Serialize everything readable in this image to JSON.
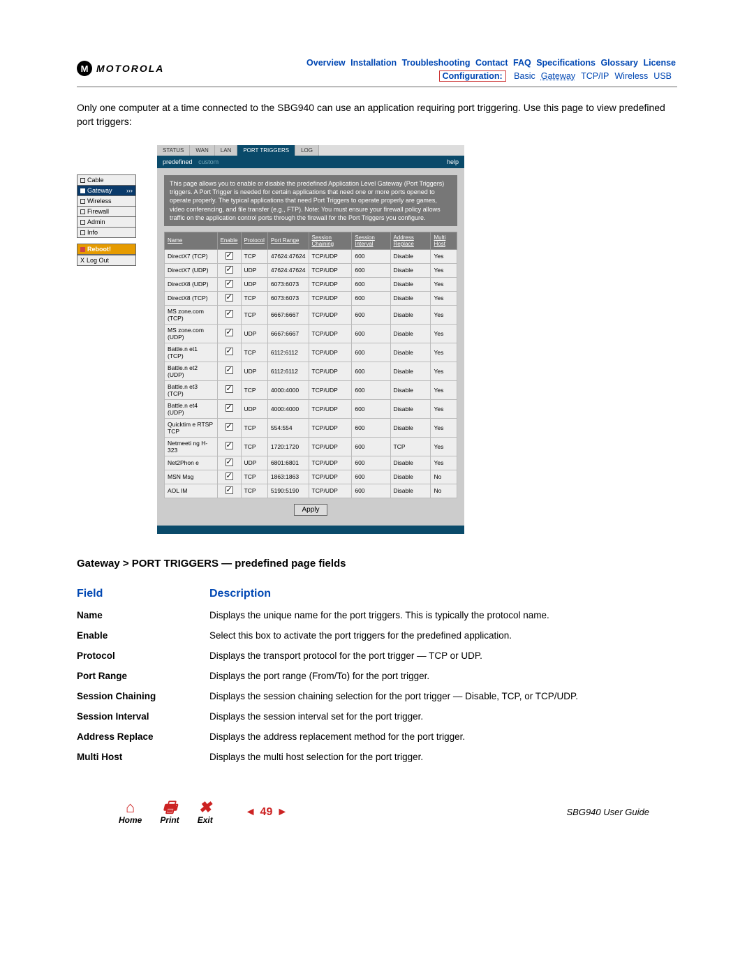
{
  "header": {
    "brand": "MOTOROLA",
    "top_links": [
      "Overview",
      "Installation",
      "Troubleshooting",
      "Contact",
      "FAQ",
      "Specifications",
      "Glossary",
      "License"
    ],
    "conf_label": "Configuration:",
    "conf_links": [
      "Basic",
      "Gateway",
      "TCP/IP",
      "Wireless",
      "USB"
    ]
  },
  "intro": "Only one computer at a time connected to the SBG940 can use an application requiring port triggering. Use this page to view predefined port triggers:",
  "sidenav": {
    "items": [
      "Cable",
      "Gateway",
      "Wireless",
      "Firewall",
      "Admin",
      "Info"
    ],
    "active_index": 1,
    "active_suffix": "›››",
    "reboot": "Reboot!",
    "logout": "Log Out"
  },
  "panel": {
    "tabs": [
      "STATUS",
      "WAN",
      "LAN",
      "PORT TRIGGERS",
      "LOG"
    ],
    "active_tab": 3,
    "subtab_active": "predefined",
    "subtab_inactive": "custom",
    "help": "help",
    "description": "This page allows you to enable or disable the predefined Application Level Gateway (Port Triggers) triggers. A Port Trigger is needed for certain applications that need one or more ports opened to operate properly. The typical applications that need Port Triggers to operate properly are games, video conferencing, and file transfer (e.g., FTP). Note: You must ensure your firewall policy allows traffic on the application control ports through the firewall for the Port Triggers you configure.",
    "columns": [
      "Name",
      "Enable",
      "Protocol",
      "Port Range",
      "Session Chaining",
      "Session Interval",
      "Address Replace",
      "Multi Host"
    ],
    "rows": [
      {
        "name": "DirectX7 (TCP)",
        "enable": true,
        "protocol": "TCP",
        "port_range": "47624:47624",
        "session_chaining": "TCP/UDP",
        "session_interval": "600",
        "address_replace": "Disable",
        "multi_host": "Yes"
      },
      {
        "name": "DirectX7 (UDP)",
        "enable": true,
        "protocol": "UDP",
        "port_range": "47624:47624",
        "session_chaining": "TCP/UDP",
        "session_interval": "600",
        "address_replace": "Disable",
        "multi_host": "Yes"
      },
      {
        "name": "DirectX8 (UDP)",
        "enable": true,
        "protocol": "UDP",
        "port_range": "6073:6073",
        "session_chaining": "TCP/UDP",
        "session_interval": "600",
        "address_replace": "Disable",
        "multi_host": "Yes"
      },
      {
        "name": "DirectX8 (TCP)",
        "enable": true,
        "protocol": "TCP",
        "port_range": "6073:6073",
        "session_chaining": "TCP/UDP",
        "session_interval": "600",
        "address_replace": "Disable",
        "multi_host": "Yes"
      },
      {
        "name": "MS zone.com (TCP)",
        "enable": true,
        "protocol": "TCP",
        "port_range": "6667:6667",
        "session_chaining": "TCP/UDP",
        "session_interval": "600",
        "address_replace": "Disable",
        "multi_host": "Yes"
      },
      {
        "name": "MS zone.com (UDP)",
        "enable": true,
        "protocol": "UDP",
        "port_range": "6667:6667",
        "session_chaining": "TCP/UDP",
        "session_interval": "600",
        "address_replace": "Disable",
        "multi_host": "Yes"
      },
      {
        "name": "Battle.n et1 (TCP)",
        "enable": true,
        "protocol": "TCP",
        "port_range": "6112:6112",
        "session_chaining": "TCP/UDP",
        "session_interval": "600",
        "address_replace": "Disable",
        "multi_host": "Yes"
      },
      {
        "name": "Battle.n et2 (UDP)",
        "enable": true,
        "protocol": "UDP",
        "port_range": "6112:6112",
        "session_chaining": "TCP/UDP",
        "session_interval": "600",
        "address_replace": "Disable",
        "multi_host": "Yes"
      },
      {
        "name": "Battle.n et3 (TCP)",
        "enable": true,
        "protocol": "TCP",
        "port_range": "4000:4000",
        "session_chaining": "TCP/UDP",
        "session_interval": "600",
        "address_replace": "Disable",
        "multi_host": "Yes"
      },
      {
        "name": "Battle.n et4 (UDP)",
        "enable": true,
        "protocol": "UDP",
        "port_range": "4000:4000",
        "session_chaining": "TCP/UDP",
        "session_interval": "600",
        "address_replace": "Disable",
        "multi_host": "Yes"
      },
      {
        "name": "Quicktim e RTSP TCP",
        "enable": true,
        "protocol": "TCP",
        "port_range": "554:554",
        "session_chaining": "TCP/UDP",
        "session_interval": "600",
        "address_replace": "Disable",
        "multi_host": "Yes"
      },
      {
        "name": "Netmeeti ng H-323",
        "enable": true,
        "protocol": "TCP",
        "port_range": "1720:1720",
        "session_chaining": "TCP/UDP",
        "session_interval": "600",
        "address_replace": "TCP",
        "multi_host": "Yes"
      },
      {
        "name": "Net2Phon e",
        "enable": true,
        "protocol": "UDP",
        "port_range": "6801:6801",
        "session_chaining": "TCP/UDP",
        "session_interval": "600",
        "address_replace": "Disable",
        "multi_host": "Yes"
      },
      {
        "name": "MSN Msg",
        "enable": true,
        "protocol": "TCP",
        "port_range": "1863:1863",
        "session_chaining": "TCP/UDP",
        "session_interval": "600",
        "address_replace": "Disable",
        "multi_host": "No"
      },
      {
        "name": "AOL IM",
        "enable": true,
        "protocol": "TCP",
        "port_range": "5190:5190",
        "session_chaining": "TCP/UDP",
        "session_interval": "600",
        "address_replace": "Disable",
        "multi_host": "No"
      }
    ],
    "apply": "Apply"
  },
  "section_heading": "Gateway > PORT TRIGGERS — predefined page fields",
  "field_table": {
    "head_field": "Field",
    "head_desc": "Description",
    "rows": [
      {
        "field": "Name",
        "desc": "Displays the unique name for the port triggers. This is typically the protocol name."
      },
      {
        "field": "Enable",
        "desc": "Select this box to activate the port triggers for the predefined application."
      },
      {
        "field": "Protocol",
        "desc": "Displays the transport protocol for the port trigger — TCP or UDP."
      },
      {
        "field": "Port Range",
        "desc": "Displays the port range (From/To) for the port trigger."
      },
      {
        "field": "Session Chaining",
        "desc": "Displays the session chaining selection for the port trigger — Disable, TCP, or TCP/UDP."
      },
      {
        "field": "Session Interval",
        "desc": "Displays the session interval set for the port trigger."
      },
      {
        "field": "Address Replace",
        "desc": "Displays the address replacement method for the port trigger."
      },
      {
        "field": "Multi Host",
        "desc": "Displays the multi host selection for the port trigger."
      }
    ]
  },
  "footer": {
    "home": "Home",
    "print": "Print",
    "exit": "Exit",
    "page_prev": "◄",
    "page_num": "49",
    "page_next": "►",
    "guide": "SBG940 User Guide"
  }
}
